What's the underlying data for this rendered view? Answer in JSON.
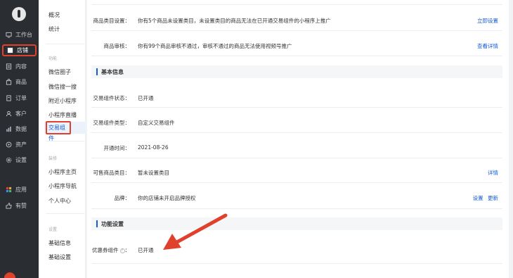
{
  "rail": {
    "items": [
      {
        "label": "工作台",
        "icon": "monitor-icon"
      },
      {
        "label": "店铺",
        "icon": "store-icon",
        "active": true
      },
      {
        "label": "内容",
        "icon": "content-icon"
      },
      {
        "label": "商品",
        "icon": "bag-icon"
      },
      {
        "label": "订单",
        "icon": "order-icon"
      },
      {
        "label": "客户",
        "icon": "user-icon"
      },
      {
        "label": "数据",
        "icon": "chart-icon"
      },
      {
        "label": "资产",
        "icon": "asset-icon"
      },
      {
        "label": "设置",
        "icon": "gear-icon"
      },
      {
        "label": "应用",
        "icon": "apps-icon"
      },
      {
        "label": "有赞",
        "icon": "like-icon"
      }
    ]
  },
  "menu": {
    "overview": "概况",
    "stats": "统计",
    "group_function": "功能",
    "wechat_circle": "微信圈子",
    "wechat_search": "微信搜一搜",
    "nearby_miniapp": "附近小程序",
    "miniapp_live": "小程序直播",
    "trade_component": "交易组件",
    "group_decoration": "装修",
    "miniapp_home": "小程序主页",
    "miniapp_nav": "小程序导航",
    "personal_center": "个人中心",
    "group_settings": "设置",
    "basic_info": "基础信息",
    "basic_settings": "基础设置"
  },
  "main": {
    "category_label": "商品类目设置：",
    "category_value": "你有5个商品未设置类目，未设置类目的商品无法在已开通交易组件的小程序上推广",
    "category_action": "立即设置",
    "audit_label": "商品审核：",
    "audit_value": "你有99个商品审核不通过，审核不通过的商品无法使用视频号推广",
    "audit_action": "查看详情",
    "section_basic": "基本信息",
    "status_label": "交易组件状态：",
    "status_value": "已开通",
    "type_label": "交易组件类型：",
    "type_value": "自定义交易组件",
    "time_label": "开通时间：",
    "time_value": "2021-08-26",
    "sellable_label": "可售商品类目：",
    "sellable_value": "暂未设置类目",
    "sellable_action": "详情",
    "brand_label": "品牌：",
    "brand_value": "你的店铺未开启品牌授权",
    "brand_action_set": "设置",
    "brand_action_update": "更新",
    "section_feature": "功能设置",
    "coupon_label": "优惠券组件",
    "coupon_colon": "：",
    "coupon_value": "已开通"
  },
  "colors": {
    "accent": "#155bd4",
    "highlight_red": "#e0412c",
    "rail_bg": "#2a2d32"
  }
}
